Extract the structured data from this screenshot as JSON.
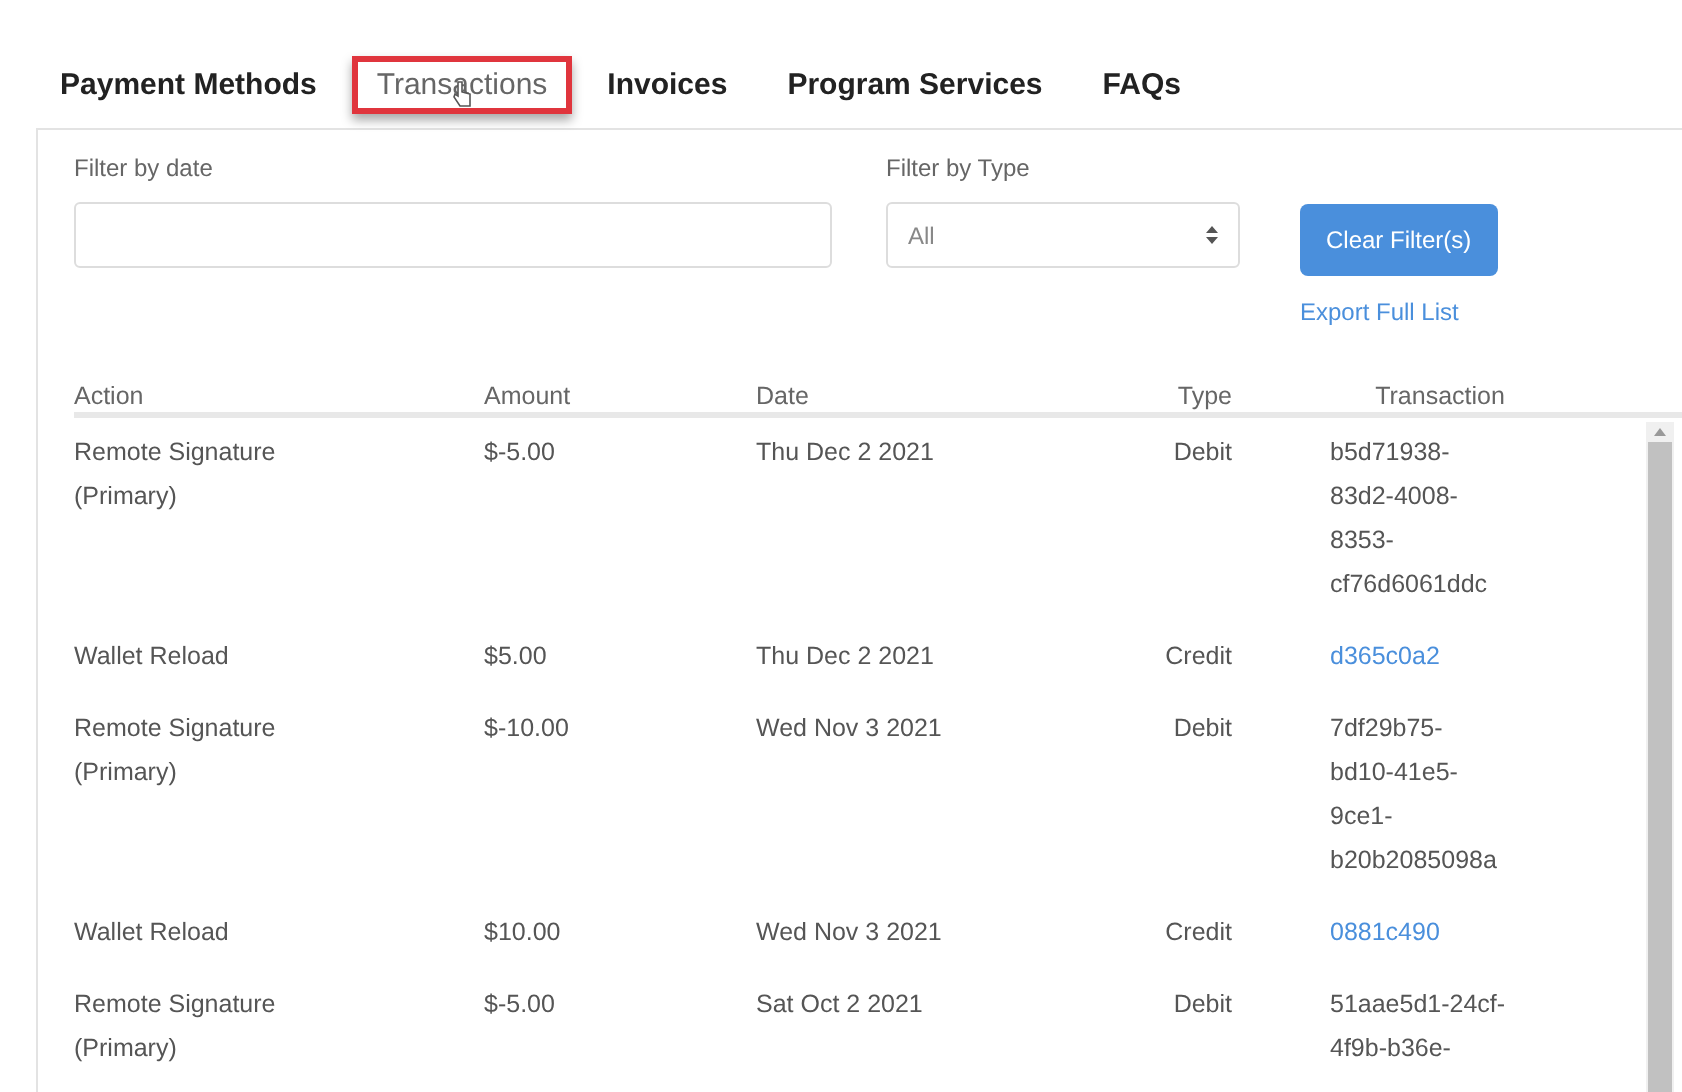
{
  "tabs": [
    {
      "label": "Payment Methods",
      "selected": false
    },
    {
      "label": "Transactions",
      "selected": true
    },
    {
      "label": "Invoices",
      "selected": false
    },
    {
      "label": "Program Services",
      "selected": false
    },
    {
      "label": "FAQs",
      "selected": false
    }
  ],
  "filters": {
    "date_label": "Filter by date",
    "type_label": "Filter by Type",
    "type_value": "All",
    "clear_button": "Clear Filter(s)",
    "export_link": "Export Full List"
  },
  "table": {
    "columns": [
      "Action",
      "Amount",
      "Date",
      "Type",
      "Transaction"
    ],
    "rows": [
      {
        "action": [
          "Remote Signature",
          "(Primary)"
        ],
        "amount": "$-5.00",
        "date": "Thu Dec 2 2021",
        "type": "Debit",
        "transaction": [
          "b5d71938-",
          "83d2-4008-",
          "8353-",
          "cf76d6061ddc"
        ],
        "link": false
      },
      {
        "action": [
          "Wallet Reload"
        ],
        "amount": "$5.00",
        "date": "Thu Dec 2 2021",
        "type": "Credit",
        "transaction": [
          "d365c0a2"
        ],
        "link": true
      },
      {
        "action": [
          "Remote Signature",
          "(Primary)"
        ],
        "amount": "$-10.00",
        "date": "Wed Nov 3 2021",
        "type": "Debit",
        "transaction": [
          "7df29b75-",
          "bd10-41e5-",
          "9ce1-",
          "b20b2085098a"
        ],
        "link": false
      },
      {
        "action": [
          "Wallet Reload"
        ],
        "amount": "$10.00",
        "date": "Wed Nov 3 2021",
        "type": "Credit",
        "transaction": [
          "0881c490"
        ],
        "link": true
      },
      {
        "action": [
          "Remote Signature",
          "(Primary)"
        ],
        "amount": "$-5.00",
        "date": "Sat Oct 2 2021",
        "type": "Debit",
        "transaction": [
          "51aae5d1-24cf-",
          "4f9b-b36e-"
        ],
        "link": false
      }
    ]
  }
}
